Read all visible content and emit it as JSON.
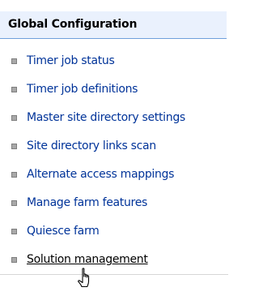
{
  "header": {
    "title": "Global Configuration"
  },
  "links": [
    {
      "label": "Timer job status"
    },
    {
      "label": "Timer job definitions"
    },
    {
      "label": "Master site directory settings"
    },
    {
      "label": "Site directory links scan"
    },
    {
      "label": "Alternate access mappings"
    },
    {
      "label": "Manage farm features"
    },
    {
      "label": "Quiesce farm"
    },
    {
      "label": "Solution management"
    }
  ],
  "cursor_icon": "hand-pointer-icon",
  "colors": {
    "header_background": "#eaf1fd",
    "header_border": "#6f9fdc",
    "link": "#003399",
    "hovered_link": "#000000",
    "bullet": "#a8a8a8"
  }
}
